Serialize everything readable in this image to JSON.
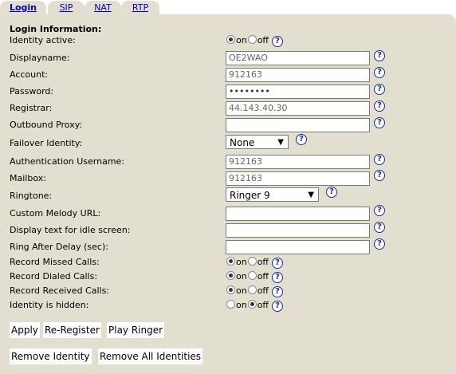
{
  "tabs": [
    "Login",
    "SIP",
    "NAT",
    "RTP"
  ],
  "section_title": "Login Information:",
  "labels": {
    "identity_active": "Identity active:",
    "displayname": "Displayname:",
    "account": "Account:",
    "password": "Password:",
    "registrar": "Registrar:",
    "outbound_proxy": "Outbound Proxy:",
    "failover_identity": "Failover Identity:",
    "auth_username": "Authentication Username:",
    "mailbox": "Mailbox:",
    "ringtone": "Ringtone:",
    "custom_melody_url": "Custom Melody URL:",
    "idle_text": "Display text for idle screen:",
    "ring_after_delay": "Ring After Delay (sec):",
    "record_missed": "Record Missed Calls:",
    "record_dialed": "Record Dialed Calls:",
    "record_received": "Record Received Calls:",
    "identity_hidden": "Identity is hidden:"
  },
  "values": {
    "displayname": "OE2WAO",
    "account": "912163",
    "password": "••••••••",
    "registrar": "44.143.40.30",
    "outbound_proxy": "",
    "failover_identity": "None",
    "auth_username": "912163",
    "mailbox": "912163",
    "ringtone": "Ringer 9",
    "custom_melody_url": "",
    "idle_text": "",
    "ring_after_delay": ""
  },
  "radio": {
    "on_label": "on",
    "off_label": "off",
    "identity_active": "on",
    "record_missed": "on",
    "record_dialed": "on",
    "record_received": "on",
    "identity_hidden": "off"
  },
  "help_symbol": "?",
  "buttons": {
    "apply": "Apply",
    "re_register": "Re-Register",
    "play_ringer": "Play Ringer",
    "remove_identity": "Remove Identity",
    "remove_all": "Remove All Identities"
  },
  "colors": {
    "panel_bg": "#e2dfd0",
    "link": "#0000cc",
    "help_icon": "#1f2b9c"
  }
}
